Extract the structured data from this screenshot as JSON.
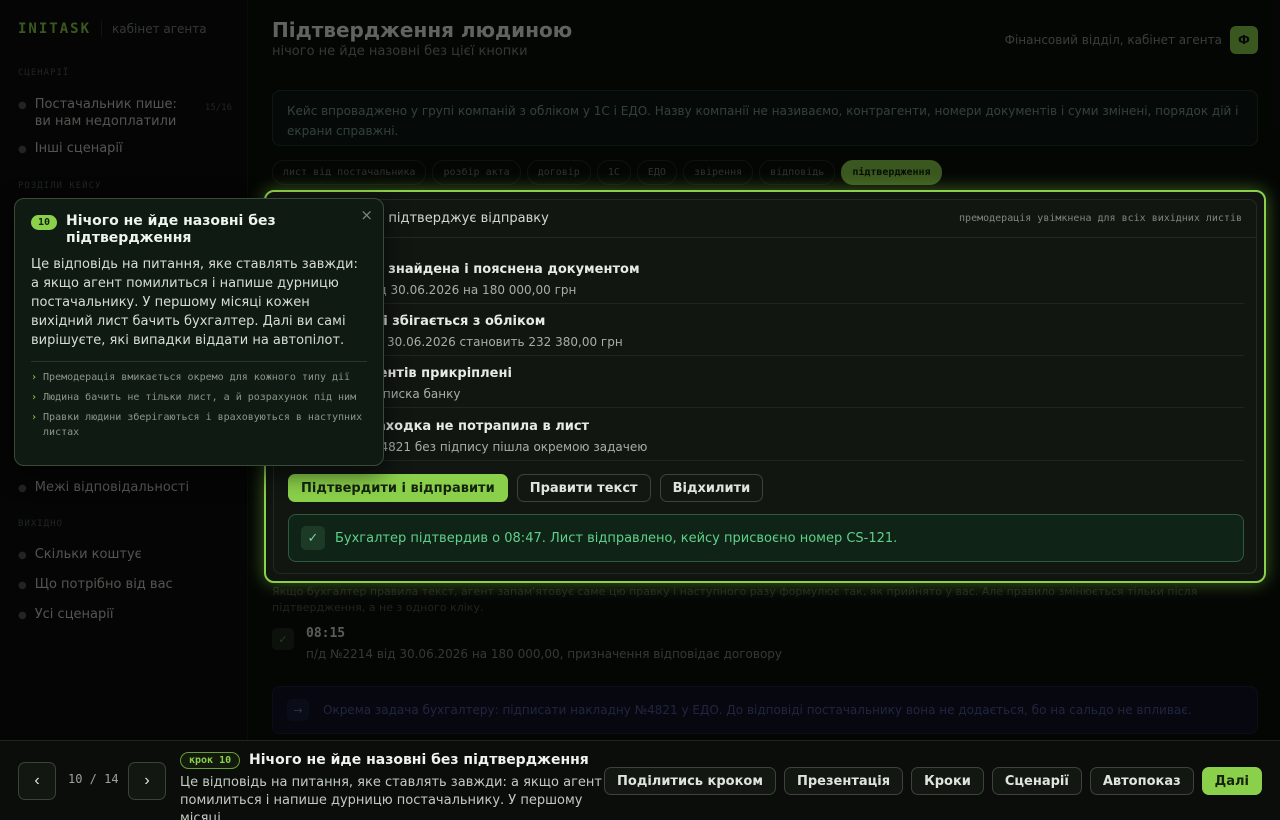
{
  "sidebar": {
    "logo": "INITASK",
    "subtitle": "кабінет агента",
    "section_scenarios": "СЦЕНАРІЇ",
    "scenario_items": [
      {
        "label": "Постачальник пише: ви нам недоплатили",
        "count": "15/16"
      },
      {
        "label": "Інші сценарії"
      }
    ],
    "section_case": "РОЗДІЛИ КЕЙСУ",
    "case_items": [
      {
        "label": "Межі відповідальності"
      }
    ],
    "section_more": "ВИХІДНО",
    "more_items": [
      {
        "label": "Скільки коштує"
      },
      {
        "label": "Що потрібно від вас"
      },
      {
        "label": "Усі сценарії"
      }
    ]
  },
  "header": {
    "title": "Підтвердження людиною",
    "subtitle": "нічого не йде назовні без цієї кнопки",
    "org": "Фінансовий відділ, кабінет агента",
    "avatar": "Ф"
  },
  "note": "Кейс впроваджено у групі компаній з обліком у 1С і ЕДО. Назву компанії не називаємо, контрагенти, номери документів і суми змінені, порядок дій і екрани справжні.",
  "tabs": [
    "лист від постачальника",
    "розбір акта",
    "договір",
    "1С",
    "ЕДО",
    "звірення",
    "відповідь",
    "підтвердження"
  ],
  "card": {
    "title": "ер підтверджує відправку",
    "tag": "премодерація увімкнена для всіх вихідних листів",
    "checks": [
      {
        "title": "ть знайдена і пояснена документом",
        "desc": "від 30.06.2026 на 180 000,00 грн"
      },
      {
        "title": "сті збігається з обліком",
        "desc": "на 30.06.2026 становить 232 380,00 грн"
      },
      {
        "title": "ментів прикріплені",
        "desc": "виписка банку"
      },
      {
        "title": "находка не потрапила в лист",
        "desc": "№4821 без підпису пішла окремою задачею"
      }
    ],
    "btn_confirm": "Підтвердити і відправити",
    "btn_edit": "Правити текст",
    "btn_reject": "Відхилити",
    "success_icon": "✓",
    "success_text": "Бухгалтер підтвердив о 08:47. Лист відправлено, кейсу присвоєно номер CS-121."
  },
  "after_text": "Якщо бухгалтер правила текст, агент запам'ятовує саме цю правку і наступного разу формулює так, як прийнято у вас. Але правило змінюється тільки після підтвердження, а не з одного кліку.",
  "timeline": {
    "icon": "✓",
    "time": "08:15",
    "desc": "п/д №2214 від 30.06.2026 на 180 000,00, призначення відповідає договору"
  },
  "task": {
    "icon": "→",
    "text": "Окрема задача бухгалтеру: підписати накладну №4821 у ЕДО. До відповіді постачальнику вона не додається, бо на сальдо не впливає."
  },
  "popover": {
    "step": "10",
    "title": "Нічого не йде назовні без підтвердження",
    "close": "×",
    "body": "Це відповідь на питання, яке ставлять завжди: а якщо агент помилиться і напише дурницю постачальнику. У першому місяці кожен вихідний лист бачить бухгалтер. Далі ви самі вирішуєте, які випадки віддати на автопілот.",
    "bullets": [
      "Премодерація вмикається окремо для кожного типу дії",
      "Людина бачить не тільки лист, а й розрахунок під ним",
      "Правки людини зберігаються і враховуються в наступних листах"
    ],
    "bullet_mark": "›"
  },
  "bottom": {
    "prev": "‹",
    "next": "›",
    "counter": "10 / 14",
    "step_label": "крок 10",
    "title": "Нічого не йде назовні без підтвердження",
    "desc": "Це відповідь на питання, яке ставлять завжди: а якщо агент помилиться і напише дурницю постачальнику. У першому місяці…",
    "actions": [
      "Поділитись кроком",
      "Презентація",
      "Кроки",
      "Сценарії",
      "Автопоказ"
    ],
    "next_label": "Далі"
  }
}
